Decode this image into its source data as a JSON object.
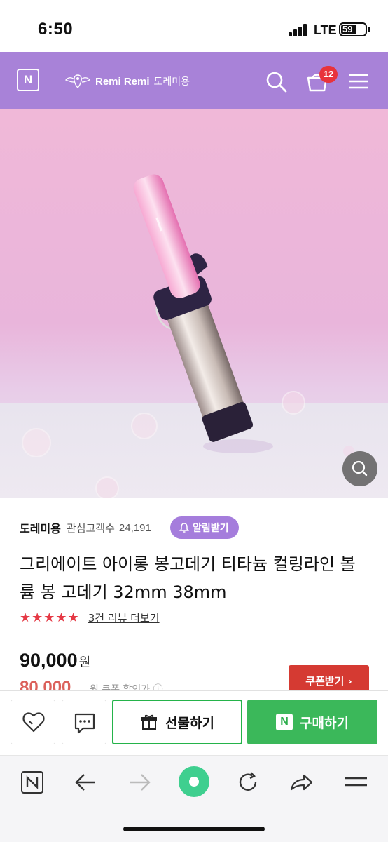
{
  "status_bar": {
    "time": "6:50",
    "network": "LTE",
    "battery": "59"
  },
  "header": {
    "logo": "N",
    "brand_name": "Remi Remi",
    "brand_korean": "도레미용",
    "cart_count": "12",
    "bg_color": "#a882d8"
  },
  "product": {
    "seller": "도레미용",
    "favorites_label": "관심고객수",
    "favorites_count": "24,191",
    "alarm_label": "알림받기",
    "title": "그리에이트 아이롱 봉고데기 티타늄 컬링라인 볼륨 봉 고데기 32mm 38mm",
    "stars": "★★★★★",
    "review_link": "3건 리뷰 더보기",
    "price": "90,000",
    "price_unit": "원",
    "sub_price": "80,000",
    "sub_price_note": "원 쿠폰 할인가 ⓘ",
    "coupon_label": "쿠폰받기 ›"
  },
  "buy_bar": {
    "gift_label": "선물하기",
    "buy_label": "구매하기",
    "buy_icon": "N",
    "accent_color": "#3bb85a"
  },
  "browser_toolbar": {
    "n_label": "N",
    "icons": [
      "n-home-icon",
      "back-arrow-icon",
      "forward-arrow-icon",
      "green-dot-icon",
      "reload-icon",
      "share-icon",
      "menu-icon"
    ]
  }
}
